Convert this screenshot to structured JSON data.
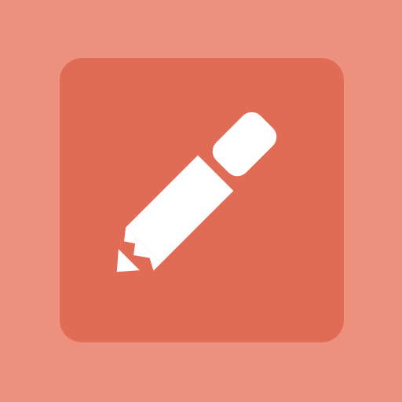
{
  "icon": {
    "name": "pencil-icon",
    "tile_color": "#e06c55",
    "glyph_color": "#ffffff"
  },
  "background_color": "#ed917e"
}
